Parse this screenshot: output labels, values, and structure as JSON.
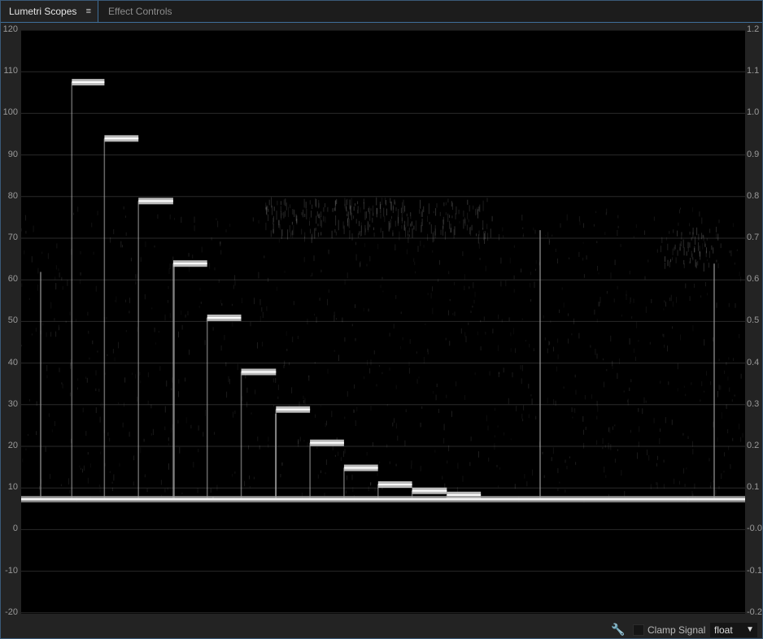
{
  "tabs": [
    {
      "label": "Lumetri Scopes",
      "menu_icon": "≡",
      "active": true
    },
    {
      "label": "Effect Controls",
      "active": false
    }
  ],
  "scope": {
    "left_axis": [
      "120",
      "110",
      "100",
      "90",
      "80",
      "70",
      "60",
      "50",
      "40",
      "30",
      "20",
      "10",
      "0",
      "-10",
      "-20"
    ],
    "right_axis": [
      "1.2",
      "1.1",
      "1.0",
      "0.9",
      "0.8",
      "0.7",
      "0.6",
      "0.5",
      "0.4",
      "0.3",
      "0.2",
      "0.1",
      "-0.0",
      "-0.1",
      "-0.2"
    ]
  },
  "footer": {
    "wrench_icon": "wrench-icon",
    "clamp_label": "Clamp Signal",
    "clamp_checked": false,
    "format_value": "float"
  },
  "chart_data": {
    "type": "scatter",
    "ylim": [
      -20,
      120
    ],
    "baseline_y": 7.5,
    "step_levels": [
      {
        "x_start": 0.07,
        "x_end": 0.115,
        "y": 107.5
      },
      {
        "x_start": 0.115,
        "x_end": 0.162,
        "y": 94
      },
      {
        "x_start": 0.162,
        "x_end": 0.21,
        "y": 79
      },
      {
        "x_start": 0.21,
        "x_end": 0.257,
        "y": 64
      },
      {
        "x_start": 0.257,
        "x_end": 0.304,
        "y": 51
      },
      {
        "x_start": 0.304,
        "x_end": 0.352,
        "y": 38
      },
      {
        "x_start": 0.352,
        "x_end": 0.399,
        "y": 29
      },
      {
        "x_start": 0.399,
        "x_end": 0.446,
        "y": 21
      },
      {
        "x_start": 0.446,
        "x_end": 0.493,
        "y": 15
      },
      {
        "x_start": 0.493,
        "x_end": 0.54,
        "y": 11
      },
      {
        "x_start": 0.54,
        "x_end": 0.588,
        "y": 9.5
      },
      {
        "x_start": 0.588,
        "x_end": 0.635,
        "y": 8.5
      }
    ]
  }
}
